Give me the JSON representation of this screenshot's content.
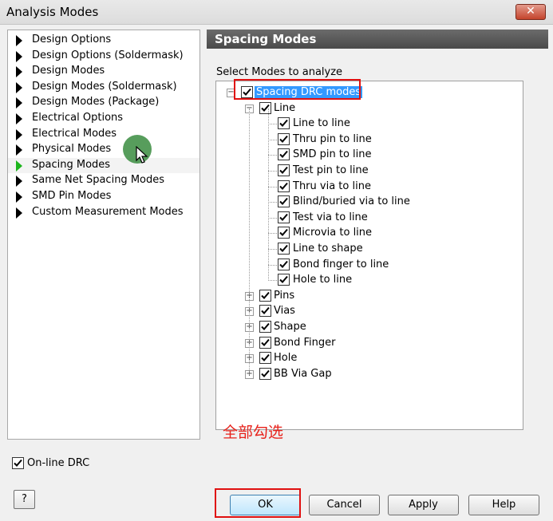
{
  "window": {
    "title": "Analysis Modes",
    "close_glyph": "✕"
  },
  "nav": {
    "items": [
      {
        "label": "Design Options",
        "icon": "arrow-right-icon"
      },
      {
        "label": "Design Options (Soldermask)",
        "icon": "arrow-right-icon"
      },
      {
        "label": "Design Modes",
        "icon": "arrow-right-icon"
      },
      {
        "label": "Design Modes (Soldermask)",
        "icon": "arrow-right-icon"
      },
      {
        "label": "Design Modes (Package)",
        "icon": "arrow-right-icon"
      },
      {
        "label": "Electrical Options",
        "icon": "arrow-right-icon"
      },
      {
        "label": "Electrical Modes",
        "icon": "arrow-right-icon"
      },
      {
        "label": "Physical Modes",
        "icon": "arrow-right-icon"
      },
      {
        "label": "Spacing Modes",
        "icon": "arrow-right-icon",
        "selected": true
      },
      {
        "label": "Same Net Spacing Modes",
        "icon": "arrow-right-icon"
      },
      {
        "label": "SMD Pin Modes",
        "icon": "arrow-right-icon"
      },
      {
        "label": "Custom Measurement Modes",
        "icon": "arrow-right-icon"
      }
    ]
  },
  "online_drc": {
    "label": "On-line DRC",
    "checked": true
  },
  "help_button": "?",
  "panel": {
    "header": "Spacing Modes",
    "select_label": "Select Modes to analyze",
    "tree": {
      "root": {
        "label": "Spacing DRC modes",
        "checked": true,
        "expanded": true
      },
      "line_group": {
        "label": "Line",
        "checked": true,
        "expanded": true
      },
      "line_items": [
        "Line to line",
        "Thru pin to line",
        "SMD pin to line",
        "Test pin to line",
        "Thru via to line",
        "Blind/buried via to line",
        "Test via to line",
        "Microvia to line",
        "Line to shape",
        "Bond finger to line",
        "Hole to line"
      ],
      "other_groups": [
        "Pins",
        "Vias",
        "Shape",
        "Bond Finger",
        "Hole",
        "BB Via Gap"
      ]
    }
  },
  "annotation": "全部勾选",
  "buttons": {
    "ok": "OK",
    "cancel": "Cancel",
    "apply": "Apply",
    "help": "Help"
  },
  "colors": {
    "highlight": "#3399ff",
    "annotation_red": "#e01010",
    "selected_arrow": "#1db51d"
  }
}
